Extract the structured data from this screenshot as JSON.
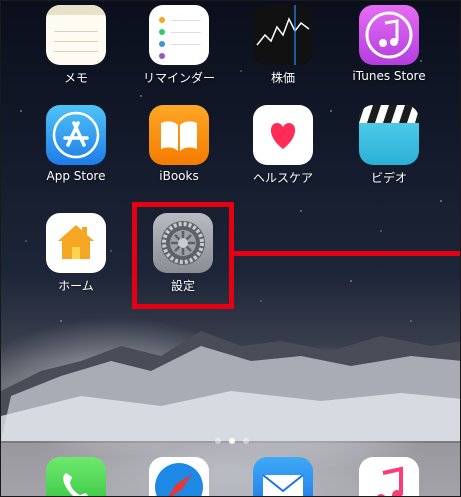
{
  "home_screen": {
    "row1": [
      {
        "label": "メモ",
        "icon": "notes-icon"
      },
      {
        "label": "リマインダー",
        "icon": "reminders-icon"
      },
      {
        "label": "株価",
        "icon": "stocks-icon"
      },
      {
        "label": "iTunes Store",
        "icon": "itunes-store-icon"
      }
    ],
    "row2": [
      {
        "label": "App Store",
        "icon": "app-store-icon"
      },
      {
        "label": "iBooks",
        "icon": "ibooks-icon"
      },
      {
        "label": "ヘルスケア",
        "icon": "health-icon"
      },
      {
        "label": "ビデオ",
        "icon": "videos-icon"
      }
    ],
    "row3": [
      {
        "label": "ホーム",
        "icon": "home-app-icon"
      },
      {
        "label": "設定",
        "icon": "settings-icon"
      }
    ]
  },
  "page_indicator": {
    "count": 3,
    "active_index": 1
  },
  "dock": [
    {
      "icon": "phone-icon"
    },
    {
      "icon": "safari-icon"
    },
    {
      "icon": "mail-icon"
    },
    {
      "icon": "music-icon"
    }
  ],
  "colors": {
    "highlight": "#e60012"
  }
}
